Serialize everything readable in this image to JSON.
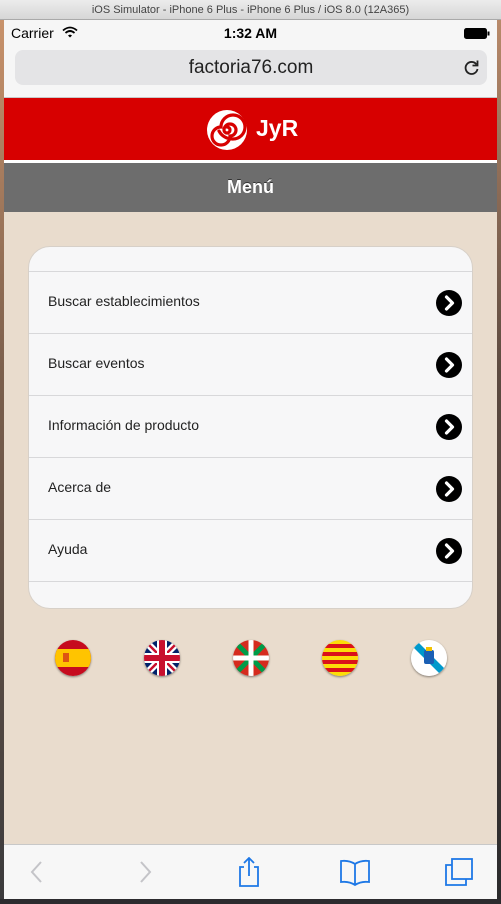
{
  "simulator": {
    "title": "iOS Simulator - iPhone 6 Plus - iPhone 6 Plus / iOS 8.0 (12A365)"
  },
  "status_bar": {
    "carrier": "Carrier",
    "time": "1:32 AM"
  },
  "browser": {
    "url": "factoria76.com"
  },
  "header": {
    "title": "JyR",
    "logo_icon": "spiral-logo-icon"
  },
  "menu_bar": {
    "title": "Menú"
  },
  "menu": {
    "items": [
      {
        "label": "Buscar establecimientos"
      },
      {
        "label": "Buscar eventos"
      },
      {
        "label": "Información de producto"
      },
      {
        "label": "Acerca de"
      },
      {
        "label": "Ayuda"
      }
    ]
  },
  "languages": [
    {
      "flag": "spain-flag-icon"
    },
    {
      "flag": "uk-flag-icon"
    },
    {
      "flag": "basque-flag-icon"
    },
    {
      "flag": "catalonia-flag-icon"
    },
    {
      "flag": "galicia-flag-icon"
    }
  ],
  "toolbar": {
    "icons": [
      "back-arrow-icon",
      "forward-arrow-icon",
      "share-icon",
      "bookmarks-icon",
      "tabs-icon"
    ]
  },
  "colors": {
    "header_red": "#d70000",
    "menu_gray": "#6d6d6d",
    "page_bg": "#e9dccd"
  }
}
